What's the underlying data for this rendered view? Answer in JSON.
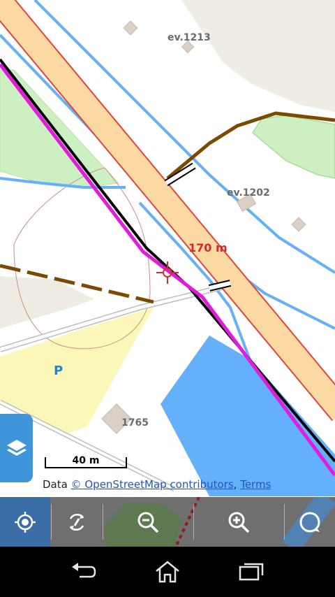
{
  "map": {
    "labels": {
      "building_1": "ev.1213",
      "building_2": "ev.1202",
      "building_3": "1765",
      "distance": "170 m",
      "parking": "P"
    },
    "scale": "40 m",
    "attribution": {
      "prefix": "Data ",
      "osm_link": "© OpenStreetMap contributors",
      "separator": ", ",
      "terms_link": "Terms"
    },
    "colors": {
      "water": "#64b0fb",
      "greenery": "#cdf0c2",
      "major_road_fill": "#fcd8a2",
      "major_road_edge": "#e0463c",
      "railway": "#000000",
      "route": "#e31bdd",
      "track": "#7a4a00",
      "parking_area": "#fbf7b9",
      "building": "#dccfc4",
      "landuse": "#f0ede4"
    }
  },
  "toolbar": {
    "buttons": [
      {
        "name": "my-location",
        "icon": "crosshair-icon"
      },
      {
        "name": "rotate-map",
        "icon": "rotate-icon"
      },
      {
        "name": "zoom-out",
        "icon": "zoom-out-icon"
      },
      {
        "name": "zoom-in",
        "icon": "zoom-in-icon"
      },
      {
        "name": "compass",
        "icon": "compass-icon"
      }
    ]
  },
  "navbar": {
    "buttons": [
      "back-icon",
      "home-icon",
      "recents-icon"
    ]
  }
}
